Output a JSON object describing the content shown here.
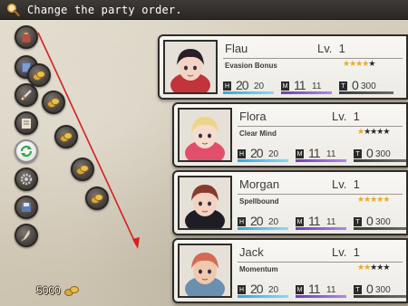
{
  "help": {
    "text": "Change the party order.",
    "icon": "magnifier-icon"
  },
  "commands": [
    {
      "name": "item",
      "icon": "bag-icon",
      "active": false
    },
    {
      "name": "skill",
      "icon": "book-icon",
      "active": false
    },
    {
      "name": "equip",
      "icon": "sword-icon",
      "active": false
    },
    {
      "name": "status",
      "icon": "card-icon",
      "active": false
    },
    {
      "name": "formation",
      "icon": "swap-icon",
      "active": true
    },
    {
      "name": "options",
      "icon": "gear-icon",
      "active": false
    },
    {
      "name": "save",
      "icon": "disk-icon",
      "active": false
    },
    {
      "name": "game-end",
      "icon": "quill-icon",
      "active": false
    }
  ],
  "gold": {
    "amount": "5000",
    "icon": "coins-icon"
  },
  "party": [
    {
      "name": "Flau",
      "level_label": "Lv.",
      "level": "1",
      "title": "Evasion Bonus",
      "stars": 4,
      "max_stars": 5,
      "hp": "20",
      "hp_max": "20",
      "mp": "11",
      "mp_max": "11",
      "tp": "0",
      "tp_max": "300",
      "hp_fill": 1.0,
      "mp_fill": 1.0,
      "tp_fill": 0.0,
      "hair": "#2a1f24",
      "accent": "#c2343a",
      "skin": "#f3d4c2"
    },
    {
      "name": "Flora",
      "level_label": "Lv.",
      "level": "1",
      "title": "Clear Mind",
      "stars": 1,
      "max_stars": 5,
      "hp": "20",
      "hp_max": "20",
      "mp": "11",
      "mp_max": "11",
      "tp": "0",
      "tp_max": "300",
      "hp_fill": 1.0,
      "mp_fill": 1.0,
      "tp_fill": 0.0,
      "hair": "#ecd58a",
      "accent": "#e24f6a",
      "skin": "#f6dccc"
    },
    {
      "name": "Morgan",
      "level_label": "Lv.",
      "level": "1",
      "title": "Spellbound",
      "stars": 5,
      "max_stars": 5,
      "hp": "20",
      "hp_max": "20",
      "mp": "11",
      "mp_max": "11",
      "tp": "0",
      "tp_max": "300",
      "hp_fill": 1.0,
      "mp_fill": 1.0,
      "tp_fill": 0.0,
      "hair": "#8a3a2d",
      "accent": "#1e1d24",
      "skin": "#f3d2c0"
    },
    {
      "name": "Jack",
      "level_label": "Lv.",
      "level": "1",
      "title": "Momentum",
      "stars": 2,
      "max_stars": 5,
      "hp": "20",
      "hp_max": "20",
      "mp": "11",
      "mp_max": "11",
      "tp": "0",
      "tp_max": "300",
      "hp_fill": 1.0,
      "mp_fill": 1.0,
      "tp_fill": 0.0,
      "hair": "#d46a55",
      "accent": "#6b8fb0",
      "skin": "#f0c9ad"
    }
  ],
  "colors": {
    "arrow": "#d81e1e",
    "card_border": "#2f2c29",
    "help_bg": "#2f2b28"
  }
}
